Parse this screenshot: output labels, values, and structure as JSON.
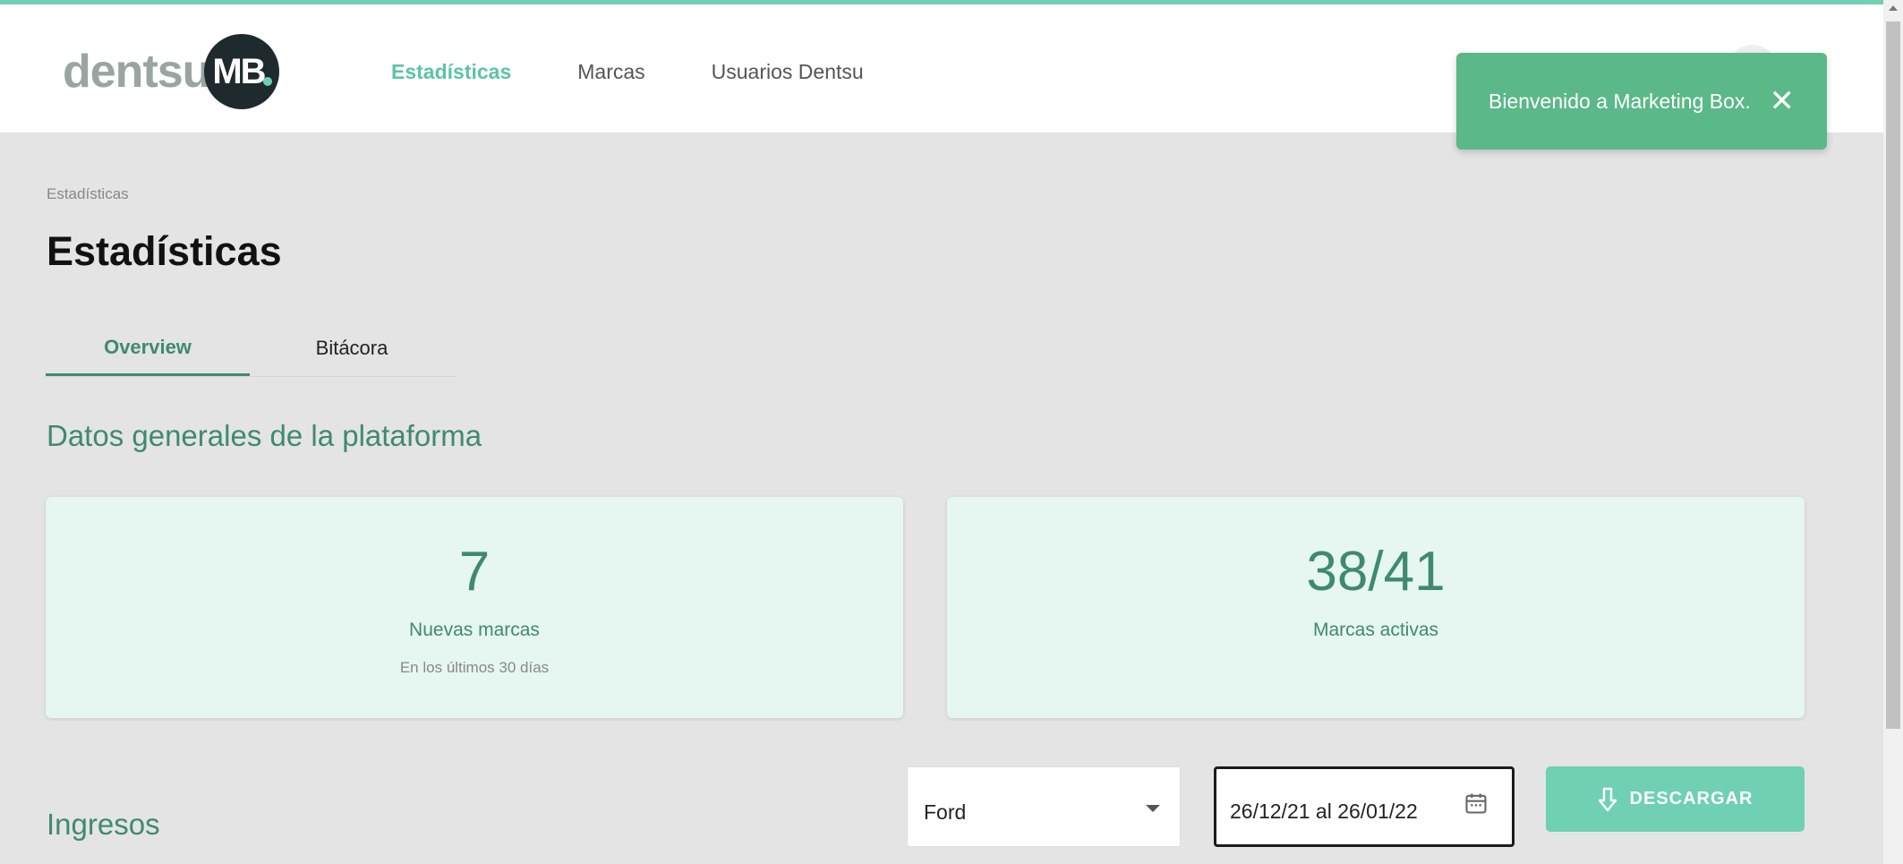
{
  "header": {
    "logo_text": "dentsu",
    "logo_mark": "MB",
    "nav": [
      {
        "label": "Estadísticas",
        "active": true
      },
      {
        "label": "Marcas",
        "active": false
      },
      {
        "label": "Usuarios Dentsu",
        "active": false
      }
    ]
  },
  "toast": {
    "message": "Bienvenido a Marketing Box.",
    "close_icon": "close-icon"
  },
  "breadcrumb": "Estadísticas",
  "page_title": "Estadísticas",
  "tabs": [
    {
      "label": "Overview",
      "active": true
    },
    {
      "label": "Bitácora",
      "active": false
    }
  ],
  "general": {
    "title": "Datos generales de la plataforma",
    "cards": [
      {
        "value": "7",
        "label": "Nuevas marcas",
        "sub": "En los últimos 30 días"
      },
      {
        "value": "38/41",
        "label": "Marcas activas"
      }
    ]
  },
  "ingresos": {
    "title": "Ingresos",
    "brand_select": {
      "value": "Ford"
    },
    "date_range": {
      "value": "26/12/21 al 26/01/22",
      "icon": "calendar-icon"
    },
    "download_label": "DESCARGAR",
    "download_icon": "download-arrow-icon"
  },
  "colors": {
    "accent": "#6fd0b4",
    "primary_text": "#3f8a6f",
    "toast": "#5bb888",
    "card_bg": "#e6f6f0",
    "page_bg": "#e4e4e4"
  }
}
